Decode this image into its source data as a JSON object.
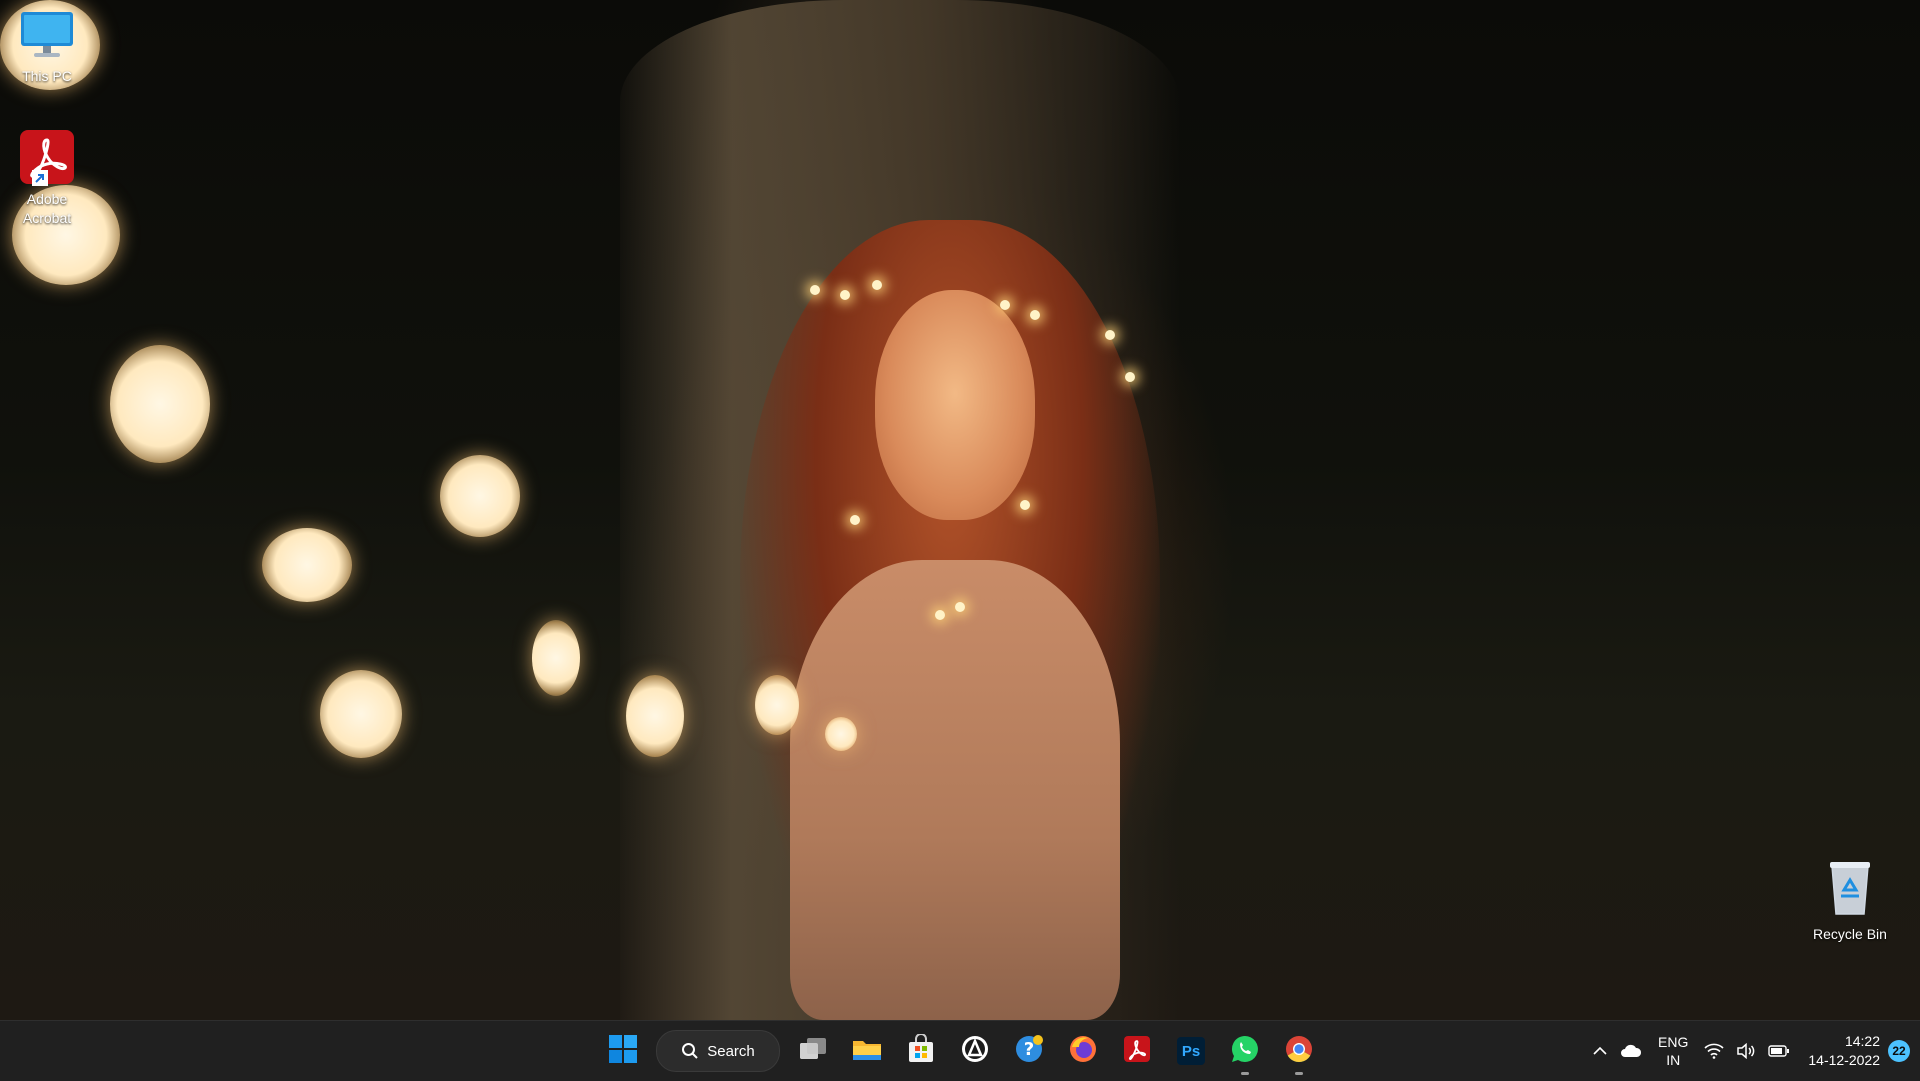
{
  "desktop": {
    "icons": [
      {
        "label": "This PC",
        "icon": "monitor-icon"
      },
      {
        "label": "Adobe\nAcrobat",
        "icon": "adobe-acrobat-icon"
      },
      {
        "label": "Recycle Bin",
        "icon": "recycle-bin-icon"
      }
    ]
  },
  "taskbar": {
    "search_label": "Search",
    "apps": [
      {
        "name": "start-icon"
      },
      {
        "name": "task-view-icon"
      },
      {
        "name": "file-explorer-icon"
      },
      {
        "name": "microsoft-store-icon"
      },
      {
        "name": "app-icon"
      },
      {
        "name": "help-icon"
      },
      {
        "name": "firefox-icon"
      },
      {
        "name": "adobe-acrobat-icon"
      },
      {
        "name": "photoshop-icon",
        "text": "Ps"
      },
      {
        "name": "whatsapp-icon"
      },
      {
        "name": "chrome-icon"
      }
    ],
    "tray": {
      "lang_top": "ENG",
      "lang_bottom": "IN",
      "time": "14:22",
      "date": "14-12-2022",
      "notification_count": "22"
    }
  },
  "colors": {
    "taskbar_bg": "#202020",
    "accent": "#4cc2ff",
    "windows_blue": "#0a84ff"
  }
}
